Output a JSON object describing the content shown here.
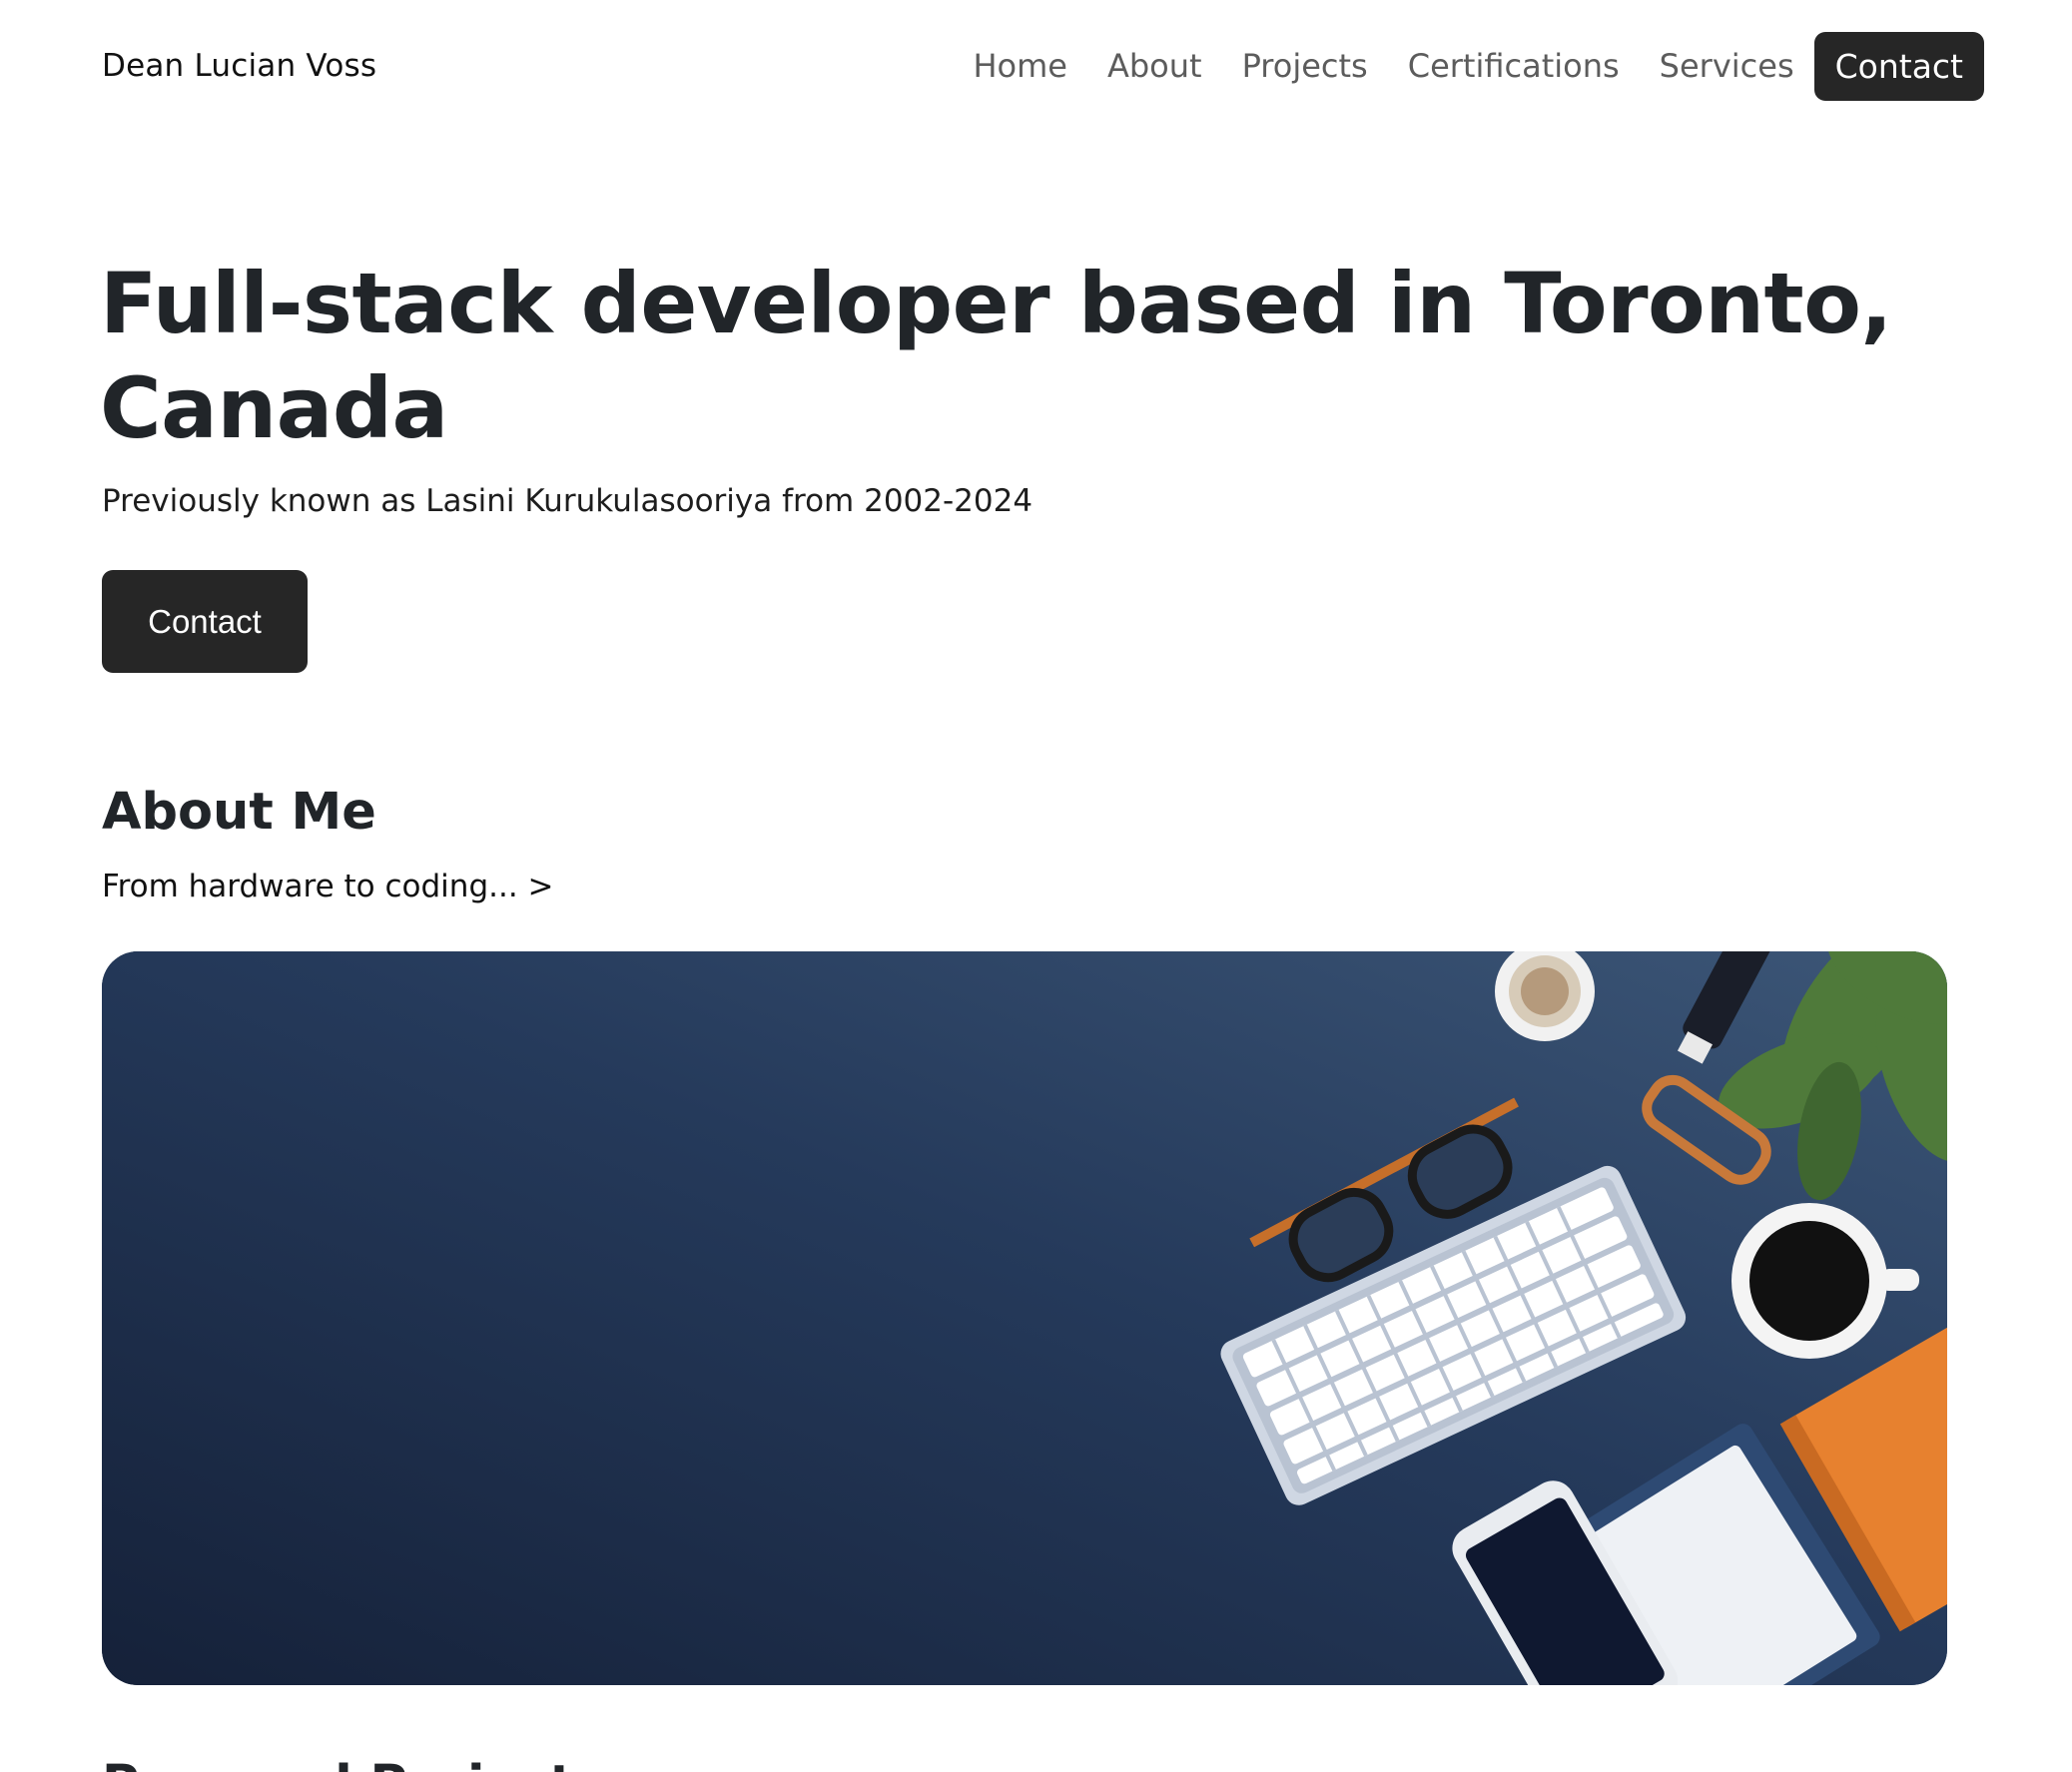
{
  "brand": {
    "name": "Dean Lucian Voss"
  },
  "nav": {
    "items": [
      {
        "label": "Home"
      },
      {
        "label": "About"
      },
      {
        "label": "Projects"
      },
      {
        "label": "Certifications"
      },
      {
        "label": "Services"
      }
    ],
    "contact_label": "Contact"
  },
  "hero": {
    "title": "Full-stack developer based in Toronto, Canada",
    "subtitle": "Previously known as Lasini Kurukulasooriya from 2002-2024",
    "button_label": "Contact"
  },
  "about": {
    "heading": "About Me",
    "link_text": "From hardware to coding... >",
    "image": {
      "desc_icon": "desk-workspace-illustration",
      "background_color": "#1f3150",
      "accent_color": "#e7812f"
    }
  },
  "next_section": {
    "heading": "Personal Projects"
  }
}
